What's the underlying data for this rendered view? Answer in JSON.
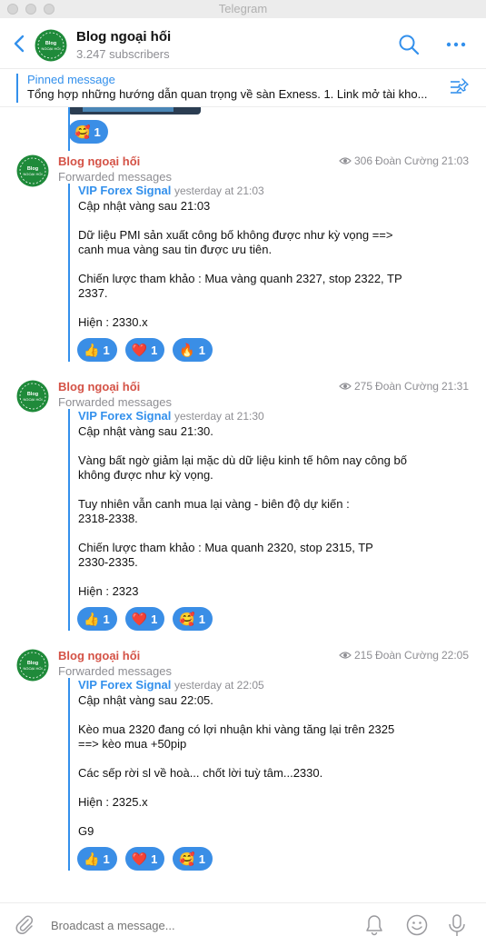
{
  "app": {
    "window_title": "Telegram"
  },
  "channel": {
    "name": "Blog ngoại hối",
    "subscribers": "3.247 subscribers",
    "avatar_text": "Blog ngoại hối"
  },
  "pinned": {
    "label": "Pinned message",
    "text": "Tổng hợp những hướng dẫn quan trọng về sàn Exness.  1. Link mở tài kho..."
  },
  "prev_reaction": {
    "emoji": "🥰",
    "count": "1"
  },
  "messages": [
    {
      "sender": "Blog ngoại hối",
      "views": "306",
      "author": "Đoàn Cường",
      "time": "21:03",
      "forward_label": "Forwarded messages",
      "fwd_from": "VIP Forex Signal",
      "fwd_time": "yesterday at 21:03",
      "text": "Cập nhật vàng sau 21:03\n\nDữ liệu PMI sản xuất công bố không được như kỳ vọng ==>\ncanh mua vàng sau tin được ưu tiên.\n\nChiến lược tham khảo : Mua vàng quanh 2327, stop 2322, TP\n2337.\n\nHiện : 2330.x",
      "reactions": [
        {
          "emoji": "👍",
          "count": "1"
        },
        {
          "emoji": "❤️",
          "count": "1"
        },
        {
          "emoji": "🔥",
          "count": "1"
        }
      ]
    },
    {
      "sender": "Blog ngoại hối",
      "views": "275",
      "author": "Đoàn Cường",
      "time": "21:31",
      "forward_label": "Forwarded messages",
      "fwd_from": "VIP Forex Signal",
      "fwd_time": "yesterday at 21:30",
      "text": "Cập nhật vàng sau 21:30.\n\nVàng bất ngờ giảm lại mặc dù dữ liệu kinh tế hôm nay công bố\nkhông được như kỳ vọng.\n\nTuy nhiên vẫn canh mua lại vàng - biên độ dự kiến :\n2318-2338.\n\nChiến lược tham khảo : Mua quanh 2320, stop 2315, TP\n2330-2335.\n\nHiện : 2323",
      "reactions": [
        {
          "emoji": "👍",
          "count": "1"
        },
        {
          "emoji": "❤️",
          "count": "1"
        },
        {
          "emoji": "🥰",
          "count": "1"
        }
      ]
    },
    {
      "sender": "Blog ngoại hối",
      "views": "215",
      "author": "Đoàn Cường",
      "time": "22:05",
      "forward_label": "Forwarded messages",
      "fwd_from": "VIP Forex Signal",
      "fwd_time": "yesterday at 22:05",
      "text": "Cập nhật vàng sau 22:05.\n\nKèo mua 2320 đang có lợi nhuận khi vàng tăng lại trên 2325\n==> kèo mua +50pip\n\nCác sếp rời sl về hoà... chốt lời tuỳ tâm...2330.\n\nHiện : 2325.x\n\nG9",
      "reactions": [
        {
          "emoji": "👍",
          "count": "1"
        },
        {
          "emoji": "❤️",
          "count": "1"
        },
        {
          "emoji": "🥰",
          "count": "1"
        }
      ]
    }
  ],
  "composer": {
    "placeholder": "Broadcast a message..."
  },
  "colors": {
    "accent": "#3390ec",
    "sender": "#d45246",
    "reaction_bg": "#3a8ee6",
    "avatar_green": "#1f8a3a"
  },
  "icons": [
    "back-arrow-icon",
    "search-icon",
    "more-icon",
    "pin-icon",
    "eye-icon",
    "attach-icon",
    "bell-icon",
    "emoji-icon",
    "mic-icon"
  ]
}
